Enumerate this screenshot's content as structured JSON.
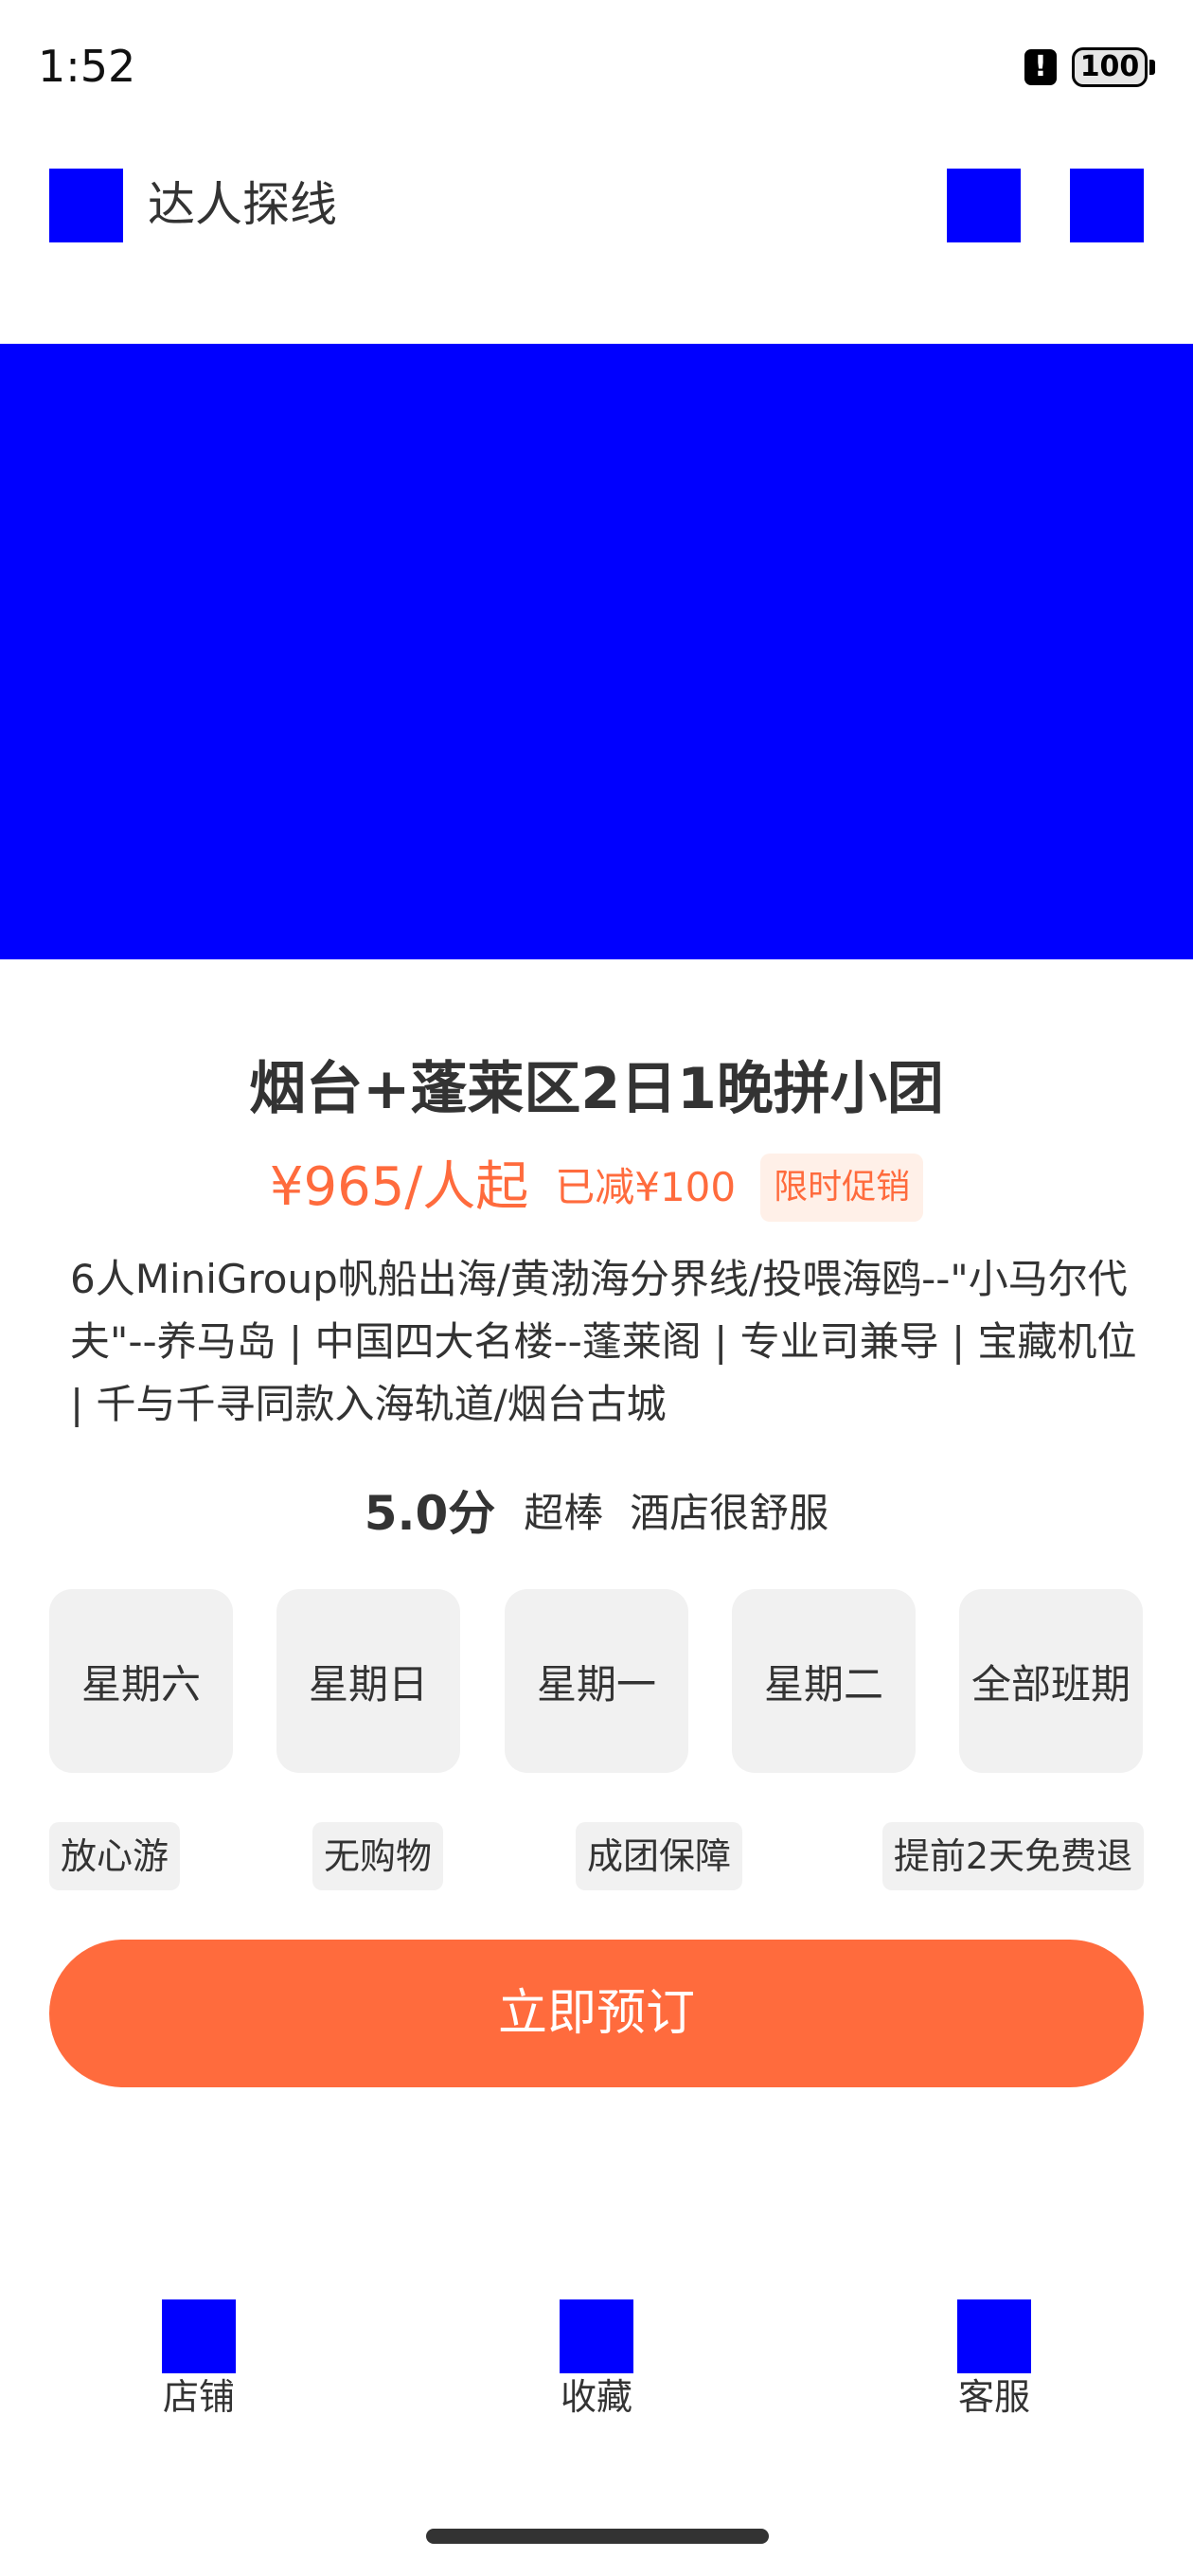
{
  "status_bar": {
    "time": "1:52",
    "battery": "100",
    "alert_symbol": "!"
  },
  "header": {
    "title": "达人探线",
    "icons": [
      "back-icon",
      "share-icon",
      "more-icon"
    ]
  },
  "product": {
    "title": "烟台+蓬莱区2日1晚拼小团",
    "price": "¥965/人起",
    "discount": "已减¥100",
    "promo_badge": "限时促销",
    "description": "6人MiniGroup帆船出海/黄渤海分界线/投喂海鸥--\"小马尔代夫\"--养马岛 | 中国四大名楼--蓬莱阁 | 专业司兼导 | 宝藏机位 | 千与千寻同款入海轨道/烟台古城"
  },
  "rating": {
    "score": "5.0分",
    "label": "超棒",
    "comment": "酒店很舒服"
  },
  "dates": [
    "星期六",
    "星期日",
    "星期一",
    "星期二",
    "全部班期"
  ],
  "tags": [
    "放心游",
    "无购物",
    "成团保障",
    "提前2天免费退"
  ],
  "book_button": "立即预订",
  "bottom_nav": [
    {
      "label": "店铺",
      "icon": "store-icon"
    },
    {
      "label": "收藏",
      "icon": "favorite-icon"
    },
    {
      "label": "客服",
      "icon": "customer-service-icon"
    }
  ],
  "colors": {
    "accent": "#ff6b3d",
    "placeholder": "#0000ff",
    "chip_bg": "#f1f1f1"
  }
}
